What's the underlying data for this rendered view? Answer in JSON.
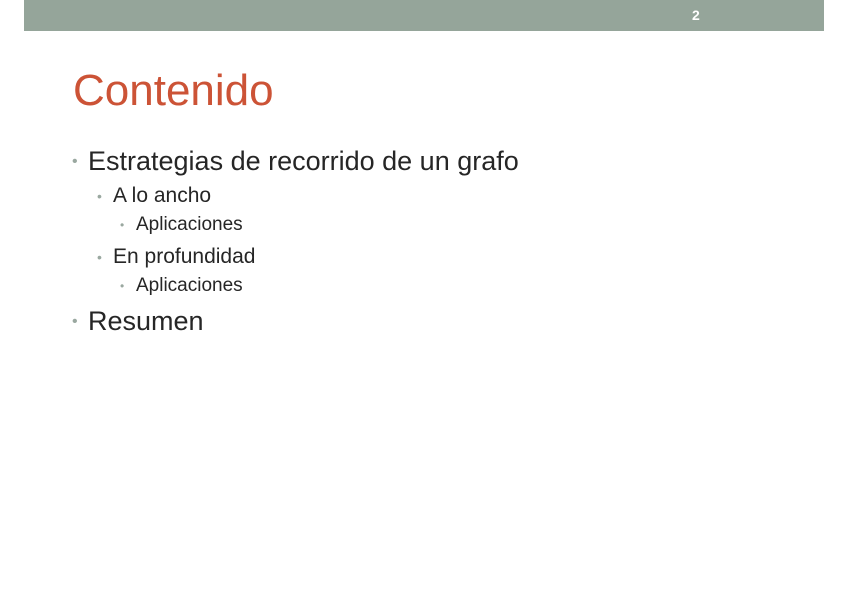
{
  "slide": {
    "number": "2",
    "title": "Contenido",
    "bullet_char": "•",
    "bullets": [
      {
        "level": 1,
        "text": "Estrategias de recorrido de un grafo"
      },
      {
        "level": 2,
        "text": "A lo ancho"
      },
      {
        "level": 3,
        "text": "Aplicaciones"
      },
      {
        "level": 2,
        "text": "En profundidad"
      },
      {
        "level": 3,
        "text": "Aplicaciones"
      },
      {
        "level": 1,
        "text": "Resumen"
      }
    ]
  },
  "colors": {
    "top_bar": "#95a59a",
    "title": "#cc5336",
    "text": "#262626",
    "bullet": "#9aa8a0"
  }
}
